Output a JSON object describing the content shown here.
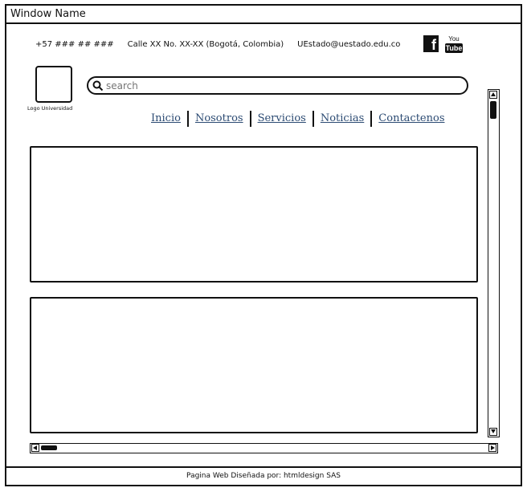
{
  "window": {
    "title": "Window Name"
  },
  "header": {
    "phone": "+57 ### ## ###",
    "address": "Calle XX No. XX-XX (Bogotá, Colombia)",
    "email": "UEstado@uestado.edu.co",
    "logo_label": "Logo Universidad",
    "social": {
      "facebook_glyph": "f",
      "youtube_top": "You",
      "youtube_bottom": "Tube"
    }
  },
  "search": {
    "placeholder": "search",
    "value": ""
  },
  "nav": {
    "items": [
      {
        "label": "Inicio"
      },
      {
        "label": "Nosotros"
      },
      {
        "label": "Servicios"
      },
      {
        "label": "Noticias"
      },
      {
        "label": "Contactenos"
      }
    ]
  },
  "footer": {
    "text": "Pagina Web Diseñada por: htmldesign SAS"
  },
  "colors": {
    "link": "#2c4b73",
    "stroke": "#111111",
    "background": "#ffffff"
  },
  "icons": [
    "search-icon",
    "facebook-icon",
    "youtube-icon",
    "scroll-up-icon",
    "scroll-down-icon",
    "scroll-left-icon",
    "scroll-right-icon"
  ]
}
